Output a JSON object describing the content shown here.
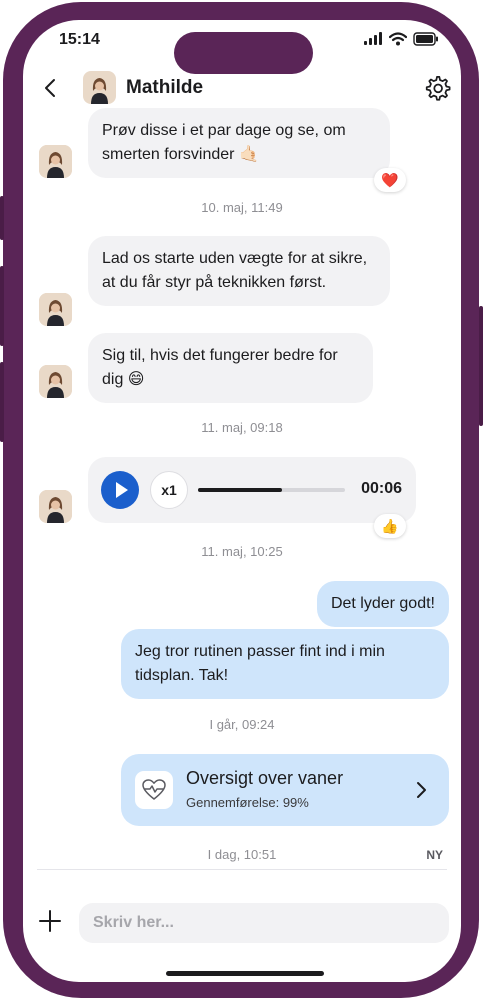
{
  "status": {
    "time": "15:14"
  },
  "header": {
    "name": "Mathilde"
  },
  "colors": {
    "frame": "#5a2557",
    "incoming_bubble": "#f2f2f4",
    "outgoing_bubble": "#cfe5fb",
    "play_button": "#1b5fcc",
    "heart": "#e0242e"
  },
  "messages": {
    "m1": "Prøv disse i et par dage og se, om smerten forsvinder 🤙🏻",
    "m1_reaction": "❤️",
    "ts1": "10. maj, 11:49",
    "m2": "Lad os starte uden vægte for at sikre, at du får styr på teknikken først.",
    "m3": "Sig til, hvis det fungerer bedre for dig 😄",
    "ts2": "11. maj, 09:18",
    "voice": {
      "speed": "x1",
      "duration": "00:06",
      "progress": 0.57
    },
    "voice_reaction": "👍",
    "ts3": "11. maj, 10:25",
    "m4": "Det lyder godt!",
    "m5": "Jeg tror rutinen passer fint ind i min tidsplan. Tak!",
    "ts4": "I går, 09:24",
    "habit_card": {
      "title": "Oversigt over vaner",
      "subtitle": "Gennemførelse: 99%"
    },
    "ts5": "I dag, 10:51",
    "new_badge": "NY"
  },
  "input": {
    "placeholder": "Skriv her..."
  },
  "icons": [
    "back-icon",
    "gear-icon",
    "play-icon",
    "heart-pulse-icon",
    "chevron-right-icon",
    "plus-icon",
    "signal-icon",
    "wifi-icon",
    "battery-icon"
  ]
}
